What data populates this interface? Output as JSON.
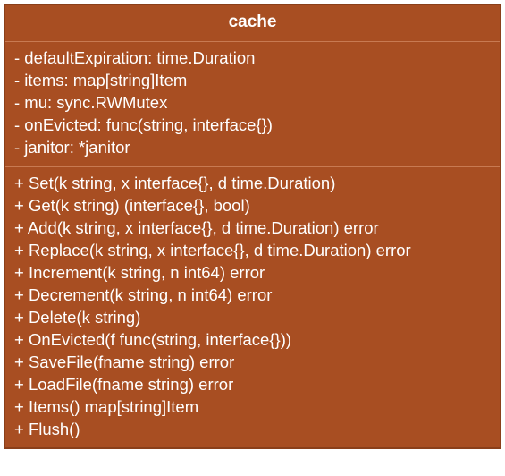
{
  "class": {
    "name": "cache",
    "attributes": [
      "- defaultExpiration: time.Duration",
      "- items: map[string]Item",
      "- mu: sync.RWMutex",
      "- onEvicted: func(string, interface{})",
      "- janitor: *janitor"
    ],
    "methods": [
      "+ Set(k string, x interface{}, d time.Duration)",
      "+ Get(k string) (interface{}, bool)",
      "+ Add(k string, x interface{}, d time.Duration) error",
      "+ Replace(k string, x interface{}, d time.Duration) error",
      "+ Increment(k string, n int64) error",
      "+ Decrement(k string, n int64) error",
      "+ Delete(k string)",
      "+ OnEvicted(f func(string, interface{}))",
      "+ SaveFile(fname string) error",
      "+ LoadFile(fname string) error",
      "+ Items() map[string]Item",
      "+ Flush()"
    ]
  }
}
